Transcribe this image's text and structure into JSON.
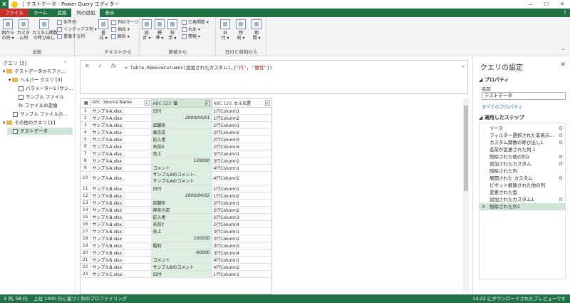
{
  "titlebar": {
    "logo": "X",
    "title": "テストデータ - Power Query エディター"
  },
  "tabs": [
    {
      "label": "ファイル"
    },
    {
      "label": "ホーム"
    },
    {
      "label": "変換"
    },
    {
      "label": "列の追加"
    },
    {
      "label": "表示"
    }
  ],
  "ribbon": {
    "general": {
      "label": "全般",
      "b1": "例から\nの列 ▾",
      "b2": "カスタ\nム列",
      "b3": "カスタム関数\nの呼び出し",
      "s1": "条件列",
      "s2": "インデックス列 ▾",
      "s3": "重複する列"
    },
    "text": {
      "label": "テキストから",
      "b1": "書\n式 ▾",
      "s1": "列のマージ",
      "s2": "抽出 ▾",
      "s3": "解析 ▾"
    },
    "number": {
      "label": "数値から",
      "b1": "統\n計 ▾",
      "b2": "標\n準 ▾",
      "b3": "科\n学 ▾",
      "s1": "三角関数 ▾",
      "s2": "丸め ▾",
      "s3": "情報 ▾"
    },
    "datetime": {
      "label": "日付と時刻から",
      "b1": "日\n付 ▾",
      "b2": "時\n刻 ▾",
      "b3": "期\n間 ▾"
    }
  },
  "left_pane": {
    "header": "クエリ [5]",
    "items": [
      {
        "label": "テストデータからファ..."
      },
      {
        "label": "ヘルパー クエリ [3]"
      },
      {
        "label": "パラメーター1 (サン..."
      },
      {
        "label": "サンプル ファイル"
      },
      {
        "label": "ファイルの変換"
      },
      {
        "label": "サンプル ファイルの..."
      },
      {
        "label": "その他のクエリ [1]"
      },
      {
        "label": "テストデータ"
      }
    ]
  },
  "formula": {
    "prefix": "= Table.RemoveColumns(追加されたカスタム1,{",
    "s1": "\"行\"",
    "mid": ", ",
    "s2": "\"属性\"",
    "suffix": "})"
  },
  "grid": {
    "columns": [
      {
        "type": "ABC",
        "name": "Source.Name"
      },
      {
        "type": "ABC 123",
        "name": "値"
      },
      {
        "type": "ABC 123",
        "name": "セル位置"
      }
    ],
    "rows": [
      [
        "1",
        "サンプルA.xlsx",
        "日付",
        "1行Column1"
      ],
      [
        "2",
        "サンプルA.xlsx",
        "2000/04/01",
        "1行Column2"
      ],
      [
        "3",
        "サンプルA.xlsx",
        "店舗名",
        "2行Column1"
      ],
      [
        "4",
        "サンプルA.xlsx",
        "東京店",
        "2行Column2"
      ],
      [
        "5",
        "サンプルA.xlsx",
        "記入者",
        "2行Column3"
      ],
      [
        "6",
        "サンプルA.xlsx",
        "名前X",
        "2行Column4"
      ],
      [
        "7",
        "サンプルA.xlsx",
        "売上",
        "3行Column1"
      ],
      [
        "8",
        "サンプルA.xlsx",
        "120000",
        "3行Column2"
      ],
      [
        "9",
        "サンプルA.xlsx",
        "コメント",
        "4行Column1"
      ],
      [
        "10",
        "サンプルA.xlsx",
        "サンプルAのコメント、\nサンプルAのコメント",
        "4行Column2"
      ],
      [
        "11",
        "サンプルB.xlsx",
        "日付",
        "1行Column1"
      ],
      [
        "12",
        "サンプルB.xlsx",
        "2000/04/02",
        "1行Column2"
      ],
      [
        "13",
        "サンプルB.xlsx",
        "店舗名",
        "2行Column1"
      ],
      [
        "14",
        "サンプルB.xlsx",
        "神奈川店",
        "2行Column2"
      ],
      [
        "15",
        "サンプルB.xlsx",
        "記入者",
        "2行Column3"
      ],
      [
        "16",
        "サンプルB.xlsx",
        "名前Y",
        "2行Column4"
      ],
      [
        "17",
        "サンプルB.xlsx",
        "売上",
        "3行Column1"
      ],
      [
        "18",
        "サンプルB.xlsx",
        "100000",
        "3行Column2"
      ],
      [
        "19",
        "サンプルB.xlsx",
        "粗利",
        "3行Column3"
      ],
      [
        "20",
        "サンプルB.xlsx",
        "60000",
        "3行Column4"
      ],
      [
        "21",
        "サンプルB.xlsx",
        "コメント",
        "4行Column1"
      ],
      [
        "22",
        "サンプルB.xlsx",
        "サンプルBのコメント",
        "4行Column2"
      ],
      [
        "23",
        "サンプルC.xlsx",
        "日付",
        "1行Column1"
      ]
    ]
  },
  "right_pane": {
    "title": "クエリの設定",
    "properties": "プロパティ",
    "name_label": "名前",
    "name_value": "テストデータ",
    "all_props": "すべてのプロパティ",
    "steps_title": "適用したステップ",
    "steps": [
      {
        "label": "ソース",
        "gear": true
      },
      {
        "label": "フィルター選択された非表示...",
        "gear": true
      },
      {
        "label": "カスタム関数の呼び出し1",
        "gear": true
      },
      {
        "label": "名前が変更された列 1",
        "gear": false
      },
      {
        "label": "削除された他の列1",
        "gear": true
      },
      {
        "label": "追加されたカスタム",
        "gear": true
      },
      {
        "label": "削除された列",
        "gear": false
      },
      {
        "label": "展開された カスタム",
        "gear": true
      },
      {
        "label": "ピボット解除された他の列",
        "gear": false
      },
      {
        "label": "変更された型",
        "gear": false
      },
      {
        "label": "追加されたカスタム1",
        "gear": true
      },
      {
        "label": "削除された列1",
        "gear": false,
        "selected": true
      }
    ]
  },
  "status": {
    "left": "3 列, 58 行　 上位 1000 行に基づく列のプロファイリング",
    "right": "14:22 にダウンロードされたプレビューです"
  }
}
